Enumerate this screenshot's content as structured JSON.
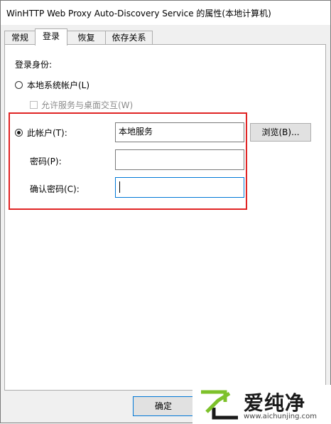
{
  "window": {
    "title": "WinHTTP Web Proxy Auto-Discovery Service 的属性(本地计算机)"
  },
  "tabs": [
    {
      "label": "常规"
    },
    {
      "label": "登录"
    },
    {
      "label": "恢复"
    },
    {
      "label": "依存关系"
    }
  ],
  "login": {
    "section_label": "登录身份:",
    "local_system_label": "本地系统帐户(L)",
    "desktop_interact_label": "允许服务与桌面交互(W)",
    "this_account_label": "此帐户(T):",
    "account_value": "本地服务",
    "browse_label": "浏览(B)...",
    "password_label": "密码(P):",
    "password_value": "",
    "confirm_password_label": "确认密码(C):",
    "confirm_password_value": ""
  },
  "footer": {
    "ok_label": "确定"
  },
  "watermark": {
    "brand": "爱纯净",
    "url": "www.aichunjing.com"
  },
  "colors": {
    "highlight": "#e02424",
    "focus": "#0078d7",
    "watermark_green": "#7dc12a"
  }
}
